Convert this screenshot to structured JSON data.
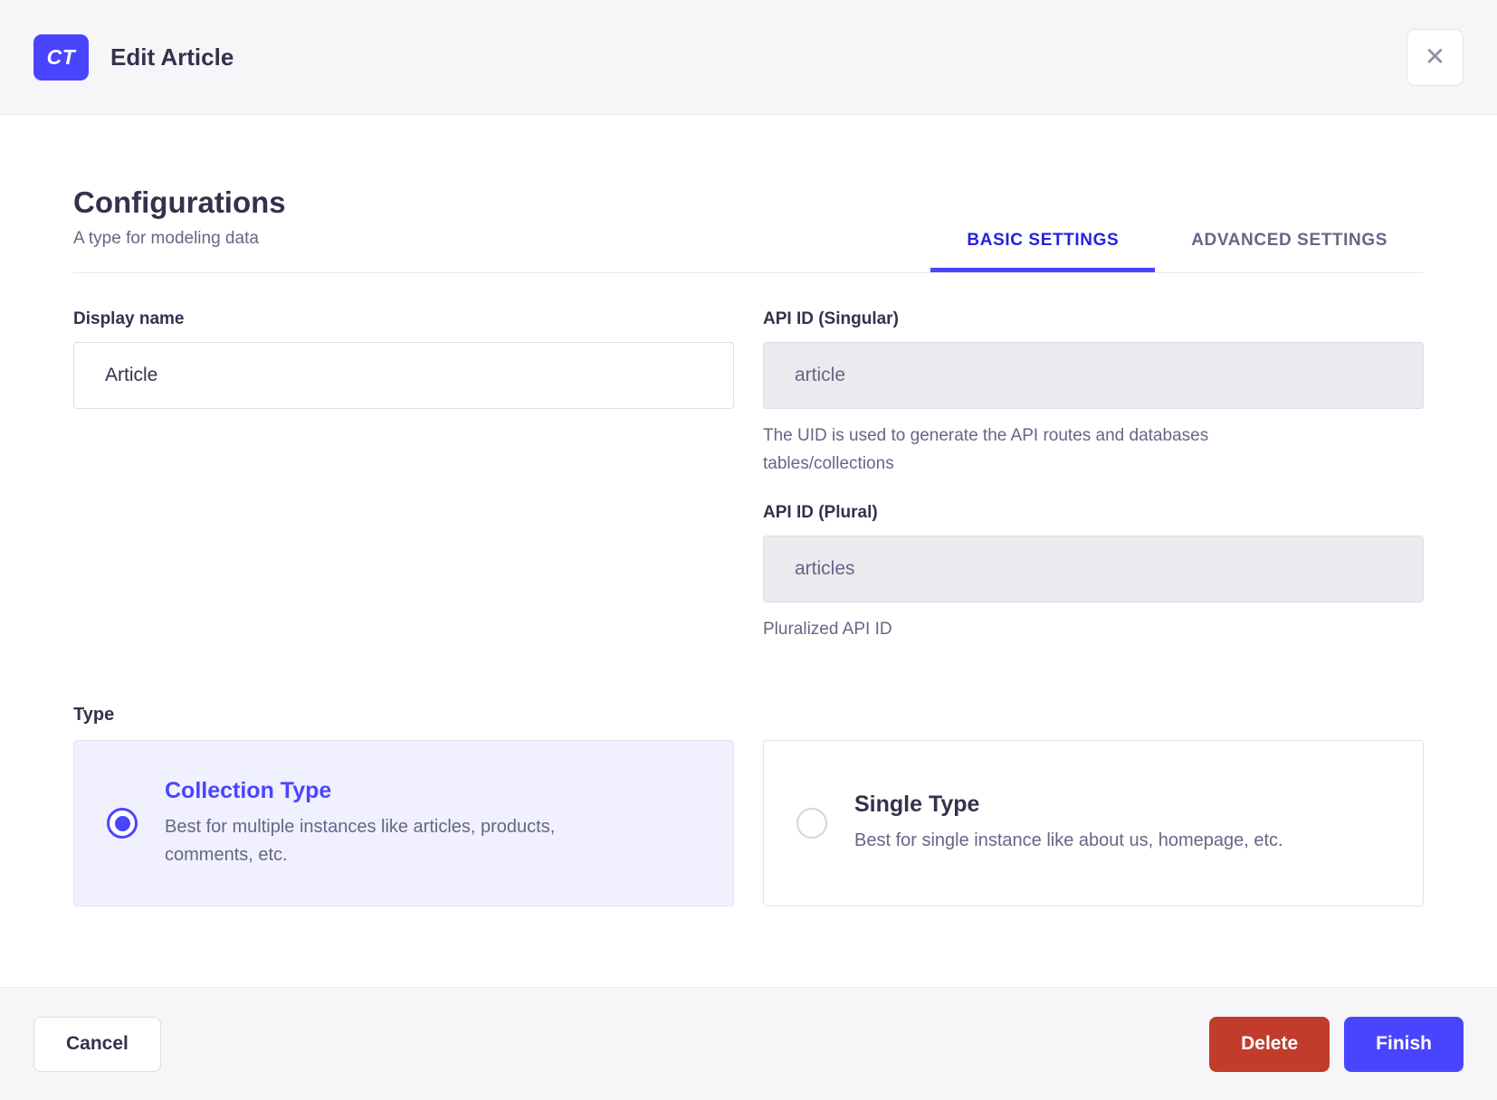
{
  "header": {
    "badge": "CT",
    "title": "Edit Article",
    "close_icon": "✕"
  },
  "section": {
    "title": "Configurations",
    "subtitle": "A type for modeling data",
    "tabs": [
      {
        "label": "BASIC SETTINGS",
        "active": true
      },
      {
        "label": "ADVANCED SETTINGS",
        "active": false
      }
    ]
  },
  "form": {
    "display_name": {
      "label": "Display name",
      "value": "Article"
    },
    "api_id_singular": {
      "label": "API ID (Singular)",
      "value": "article",
      "hint": "The UID is used to generate the API routes and databases tables/collections"
    },
    "api_id_plural": {
      "label": "API ID (Plural)",
      "value": "articles",
      "hint": "Pluralized API ID"
    },
    "type": {
      "label": "Type",
      "options": [
        {
          "title": "Collection Type",
          "description": "Best for multiple instances like articles, products, comments, etc.",
          "selected": true
        },
        {
          "title": "Single Type",
          "description": "Best for single instance like about us, homepage, etc.",
          "selected": false
        }
      ]
    }
  },
  "footer": {
    "cancel_label": "Cancel",
    "delete_label": "Delete",
    "finish_label": "Finish"
  },
  "colors": {
    "primary": "#4945ff",
    "tab_active_text": "#271fe0",
    "danger": "#c23c2b",
    "selected_card_bg": "#f0f0ff",
    "muted_text": "#666687",
    "dark_text": "#32324d",
    "chrome_bg": "#f6f6f9"
  }
}
